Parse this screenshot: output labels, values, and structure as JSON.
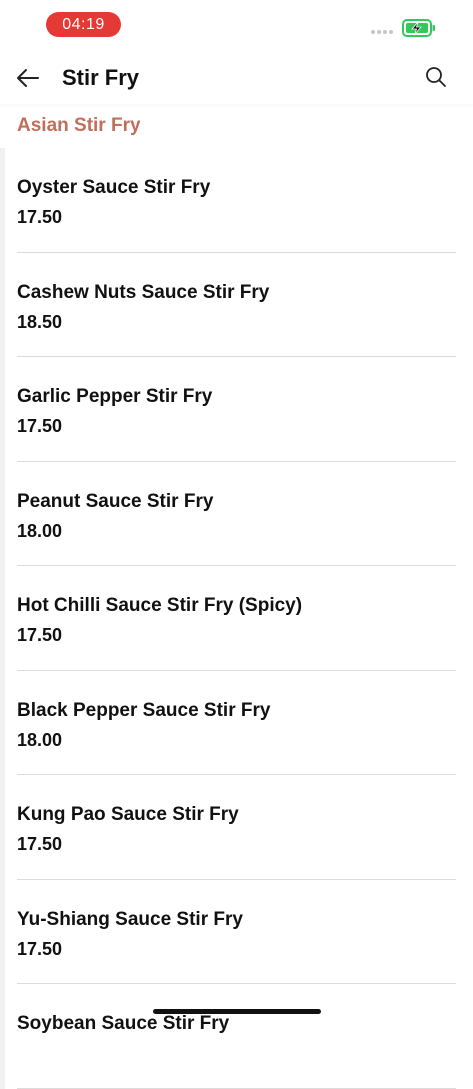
{
  "status_bar": {
    "time": "04:19",
    "time_pill_color": "#e53935",
    "battery_color": "#34c759"
  },
  "header": {
    "title": "Stir Fry",
    "back_icon": "arrow-left-icon",
    "search_icon": "search-icon"
  },
  "section": {
    "title": "Asian Stir Fry",
    "color": "#c0705a"
  },
  "items": [
    {
      "name": "Oyster Sauce Stir Fry",
      "price": "17.50"
    },
    {
      "name": "Cashew Nuts Sauce Stir Fry",
      "price": "18.50"
    },
    {
      "name": "Garlic Pepper Stir Fry",
      "price": "17.50"
    },
    {
      "name": "Peanut Sauce Stir Fry",
      "price": "18.00"
    },
    {
      "name": "Hot Chilli Sauce Stir Fry (Spicy)",
      "price": "17.50"
    },
    {
      "name": "Black Pepper Sauce Stir Fry",
      "price": "18.00"
    },
    {
      "name": "Kung Pao Sauce Stir Fry",
      "price": "17.50"
    },
    {
      "name": "Yu-Shiang Sauce Stir Fry",
      "price": "17.50"
    },
    {
      "name": "Soybean Sauce Stir Fry",
      "price": ""
    }
  ]
}
